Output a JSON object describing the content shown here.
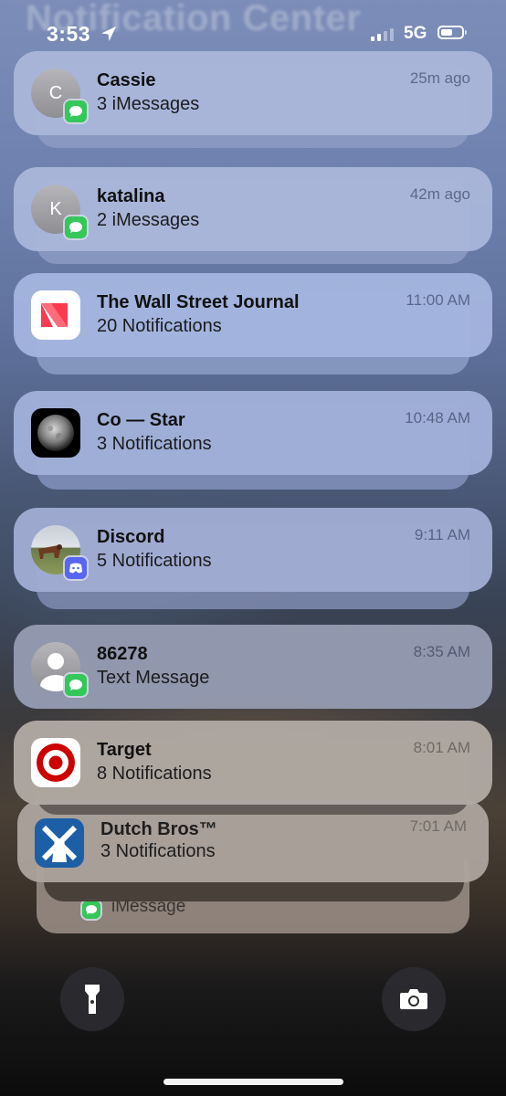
{
  "notification_center": {
    "title": "Notification Center"
  },
  "status_bar": {
    "time": "3:53",
    "network": "5G",
    "icons": [
      "location-arrow-icon",
      "signal-bars-icon",
      "battery-icon"
    ]
  },
  "notifications": [
    {
      "app": "Cassie",
      "summary": "3 iMessages",
      "time": "25m ago",
      "avatar_letter": "C",
      "badge": "messages-icon"
    },
    {
      "app": "katalina",
      "summary": "2 iMessages",
      "time": "42m ago",
      "avatar_letter": "K",
      "badge": "messages-icon"
    },
    {
      "app": "The Wall Street Journal",
      "summary": "20 Notifications",
      "time": "11:00 AM",
      "icon": "apple-news-icon"
    },
    {
      "app": "Co — Star",
      "summary": "3 Notifications",
      "time": "10:48 AM",
      "icon": "co-star-moon-icon"
    },
    {
      "app": "Discord",
      "summary": "5 Notifications",
      "time": "9:11 AM",
      "icon": "contact-photo-icon",
      "badge": "discord-icon"
    },
    {
      "app": "86278",
      "summary": "Text Message",
      "time": "8:35 AM",
      "icon": "person-silhouette-icon",
      "badge": "messages-icon"
    },
    {
      "app": "Target",
      "summary": "8 Notifications",
      "time": "8:01 AM",
      "icon": "target-logo-icon"
    },
    {
      "app": "Dutch Bros™",
      "summary": "3 Notifications",
      "time": "7:01 AM",
      "icon": "dutch-bros-windmill-icon"
    },
    {
      "summary": "iMessage",
      "badge": "messages-icon"
    }
  ],
  "lock_controls": {
    "left": "flashlight-icon",
    "right": "camera-icon"
  },
  "colors": {
    "card_top": "#aab6d8",
    "card_bottom": "#a49a92",
    "messages_green": "#34c759",
    "discord_blurple": "#5865f2",
    "target_red": "#cc0000",
    "dutch_blue": "#1d5fa6"
  }
}
